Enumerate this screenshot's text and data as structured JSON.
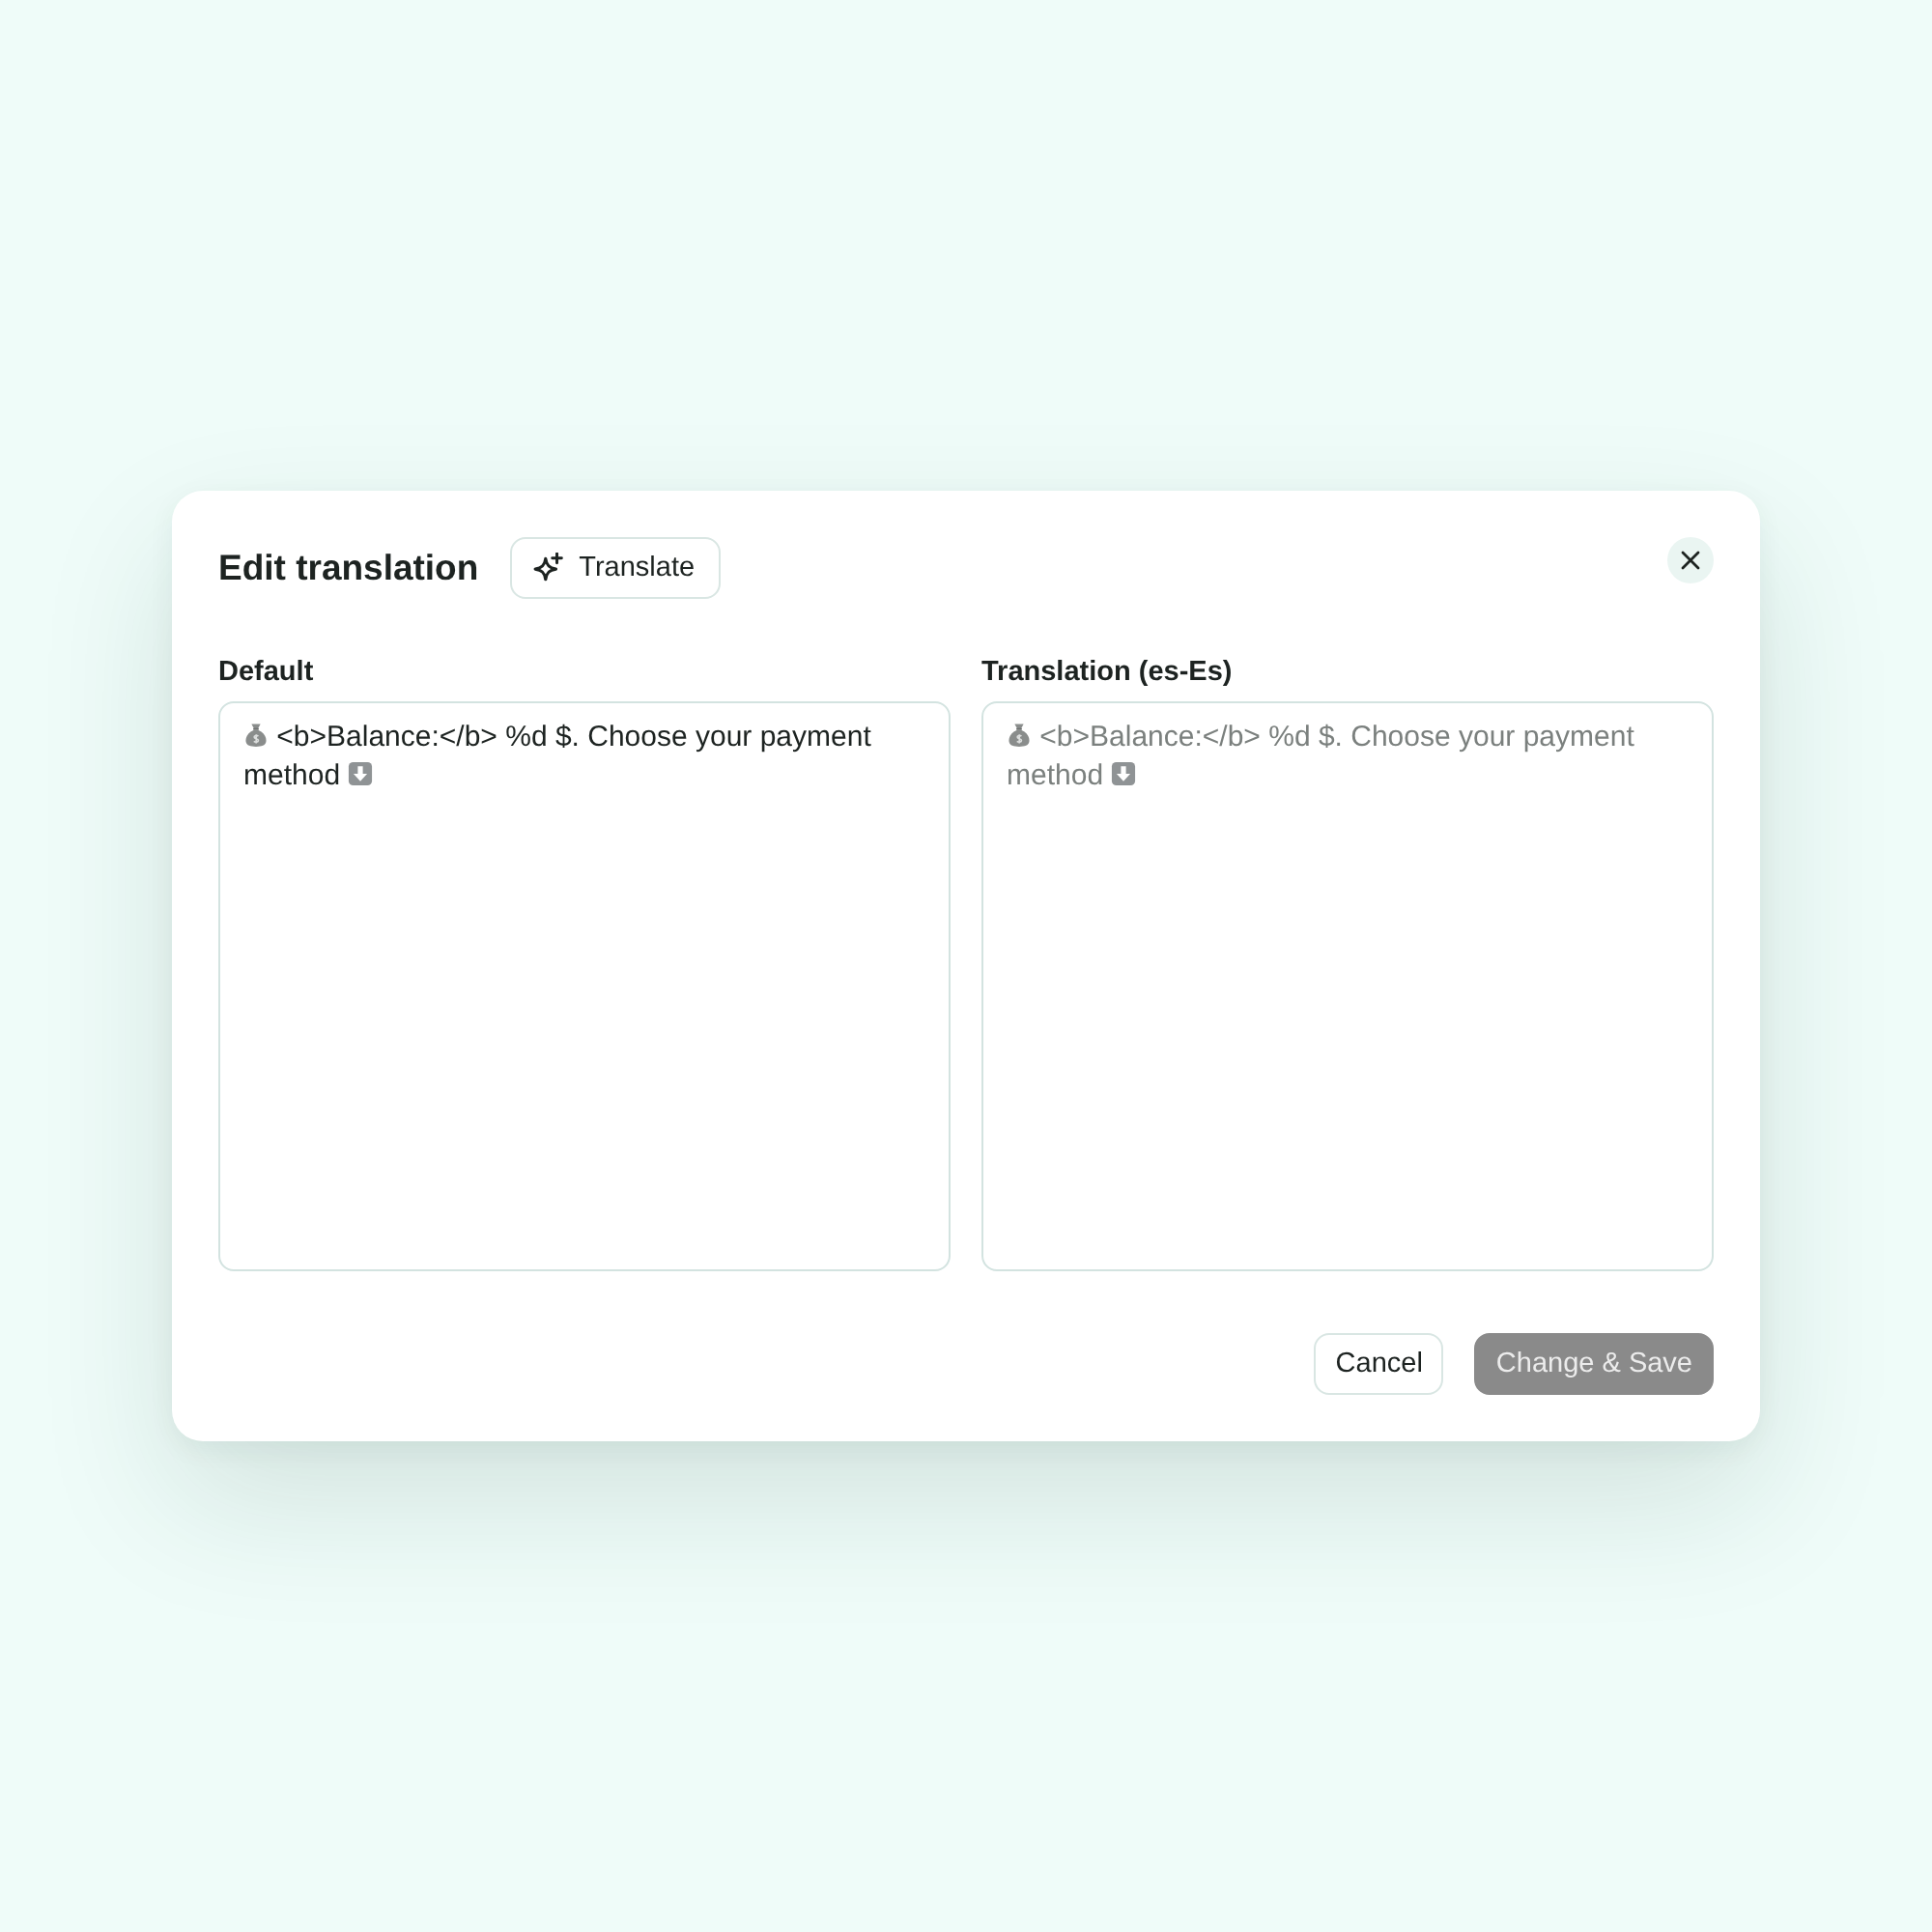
{
  "dialog": {
    "title": "Edit translation",
    "translate_button": "Translate"
  },
  "fields": [
    {
      "label": "Default",
      "value": "<b>Balance:</b> %d $. Choose your payment method"
    },
    {
      "label": "Translation (es-Es)",
      "placeholder": "<b>Balance:</b> %d $. Choose your payment method"
    }
  ],
  "buttons": [
    {
      "label": "Cancel",
      "kind": "secondary",
      "disabled": false
    },
    {
      "label": "Change & Save",
      "kind": "primary",
      "disabled": true
    }
  ]
}
